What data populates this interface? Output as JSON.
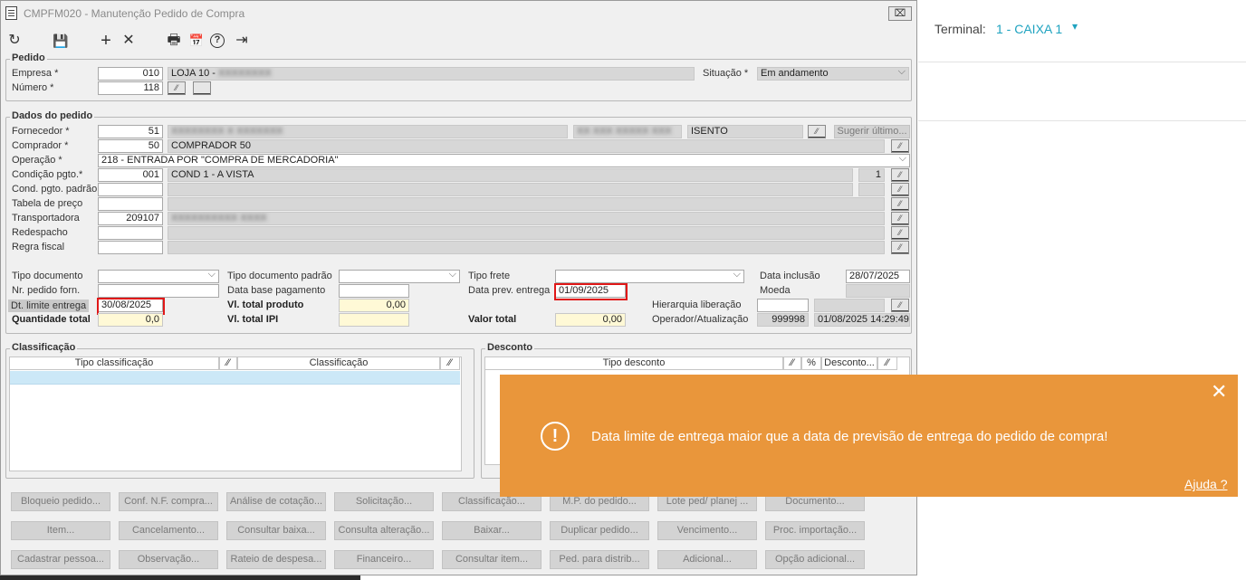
{
  "window": {
    "title": "CMPFM020 - Manutenção Pedido de Compra",
    "close_label": "⌧"
  },
  "toolbar": {
    "refresh": "↻",
    "save": "💾",
    "add": "+",
    "cancel": "✕",
    "print": "🖶",
    "calendar": "📅",
    "help": "?",
    "exit": "⇥"
  },
  "terminal": {
    "label": "Terminal:",
    "value": "1 - CAIXA 1",
    "caret": "▾",
    "accent": "#1fa3c0"
  },
  "pedido": {
    "section": "Pedido",
    "empresa_label": "Empresa *",
    "empresa_code": "010",
    "empresa_name": "LOJA 10 -",
    "empresa_blur": "XXXXXXXX",
    "situacao_label": "Situação *",
    "situacao_value": "Em andamento",
    "numero_label": "Número *",
    "numero_value": "118"
  },
  "dados": {
    "section": "Dados do pedido",
    "fornecedor_label": "Fornecedor *",
    "fornecedor_code": "51",
    "fornecedor_blur": "XXXXXXXX X XXXXXXX",
    "fornecedor_blur2": "XX XXX XXXXX XXX",
    "fornecedor_ie": "ISENTO",
    "sugerir": "Sugerir último...",
    "comprador_label": "Comprador *",
    "comprador_code": "50",
    "comprador_name": "COMPRADOR 50",
    "operacao_label": "Operação *",
    "operacao_value": "218 - ENTRADA POR \"COMPRA DE MERCADORIA\"",
    "condicao_label": "Condição pgto.*",
    "condicao_code": "001",
    "condicao_name": "COND 1 - A VISTA",
    "condicao_num": "1",
    "cond_padrao_label": "Cond. pgto. padrão",
    "tabela_label": "Tabela de preço",
    "transportadora_label": "Transportadora",
    "transportadora_code": "209107",
    "transportadora_blur": "XXXXXXXXXX XXXX",
    "redespacho_label": "Redespacho",
    "regra_label": "Regra fiscal",
    "tipo_doc_label": "Tipo documento",
    "tipo_doc_padrao_label": "Tipo documento padrão",
    "tipo_frete_label": "Tipo frete",
    "data_inclusao_label": "Data inclusão",
    "data_inclusao_value": "28/07/2025",
    "nr_pedido_label": "Nr. pedido forn.",
    "data_base_label": "Data base pagamento",
    "data_prev_label": "Data prev. entrega",
    "data_prev_value": "01/09/2025",
    "moeda_label": "Moeda",
    "dt_limite_label": "Dt. limite entrega",
    "dt_limite_value": "30/08/2025",
    "vl_total_prod_label": "Vl. total produto",
    "vl_total_prod_value": "0,00",
    "hierarquia_label": "Hierarquia liberação",
    "quantidade_label": "Quantidade total",
    "quantidade_value": "0,0",
    "vl_total_ipi_label": "Vl. total IPI",
    "valor_total_label": "Valor total",
    "valor_total_value": "0,00",
    "operador_label": "Operador/Atualização",
    "operador_value": "999998",
    "atualizacao_value": "01/08/2025 14:29:49"
  },
  "classificacao": {
    "section": "Classificação",
    "col1": "Tipo classificação",
    "col2": "Classificação"
  },
  "desconto": {
    "section": "Desconto",
    "col1": "Tipo desconto",
    "col2": "%",
    "col3": "Desconto..."
  },
  "toast": {
    "message": "Data limite de entrega maior que a data de previsão de entrega do pedido de compra!",
    "help": "Ajuda ?",
    "icon": "!",
    "close": "✕",
    "color": "#e9963b"
  },
  "buttons": {
    "row1": [
      "Bloqueio pedido...",
      "Conf. N.F. compra...",
      "Análise de cotação...",
      "Solicitação...",
      "Classificação...",
      "M.P. do pedido...",
      "Lote ped/ planej ...",
      "Documento..."
    ],
    "row2": [
      "Item...",
      "Cancelamento...",
      "Consultar baixa...",
      "Consulta alteração...",
      "Baixar...",
      "Duplicar pedido...",
      "Vencimento...",
      "Proc. importação..."
    ],
    "row3": [
      "Cadastrar pessoa...",
      "Observação...",
      "Rateio de despesa...",
      "Financeiro...",
      "Consultar item...",
      "Ped. para distrib...",
      "Adicional...",
      "Opção adicional..."
    ]
  }
}
